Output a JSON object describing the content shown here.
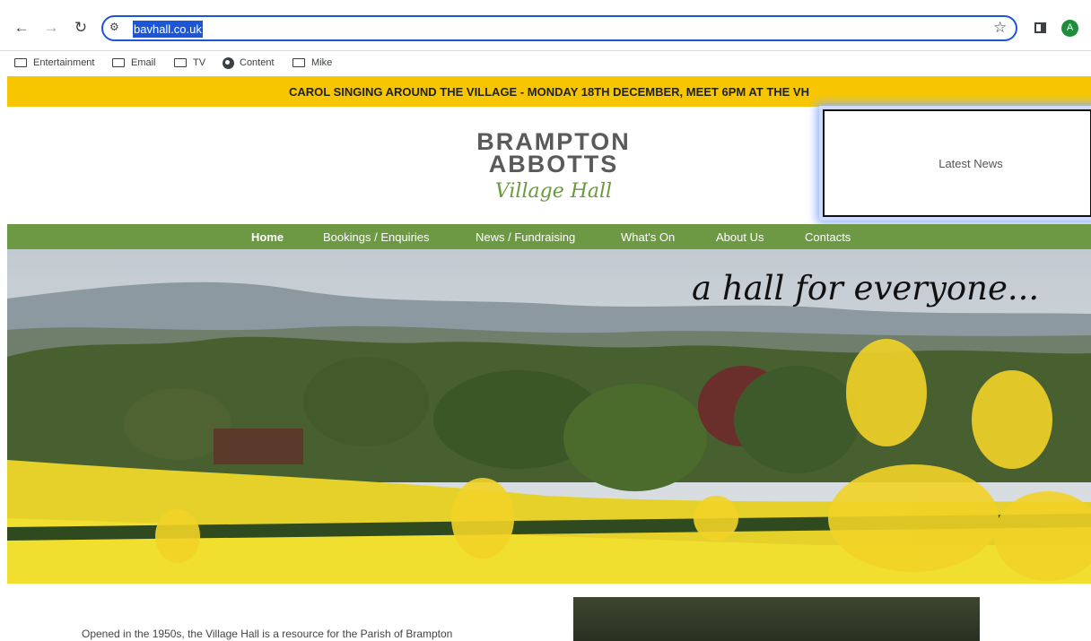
{
  "browser": {
    "url": "bavhall.co.uk",
    "profile_initial": "A",
    "nav_icons": [
      "back-arrow-icon",
      "forward-arrow-icon",
      "reload-icon"
    ],
    "bookmarks": [
      {
        "label": "Entertainment",
        "icon": "folder-icon"
      },
      {
        "label": "Email",
        "icon": "folder-icon"
      },
      {
        "label": "TV",
        "icon": "folder-icon"
      },
      {
        "label": "Content",
        "icon": "globe-icon"
      },
      {
        "label": "Mike",
        "icon": "folder-icon"
      }
    ],
    "accent_color": "#1a56d6"
  },
  "banner": {
    "text": "CAROL SINGING AROUND THE VILLAGE - MONDAY 18TH DECEMBER, MEET 6PM AT THE VH",
    "color": "#f7c600"
  },
  "logo": {
    "line1": "BRAMPTON",
    "line2": "ABBOTTS",
    "line3": "Village Hall"
  },
  "news_box": {
    "label": "Latest News"
  },
  "nav": {
    "color": "#6e9944",
    "items": [
      {
        "label": "Home",
        "active": true
      },
      {
        "label": "Bookings / Enquiries"
      },
      {
        "label": "News / Fundraising"
      },
      {
        "label": "What's On"
      },
      {
        "label": "About Us"
      },
      {
        "label": "Contacts"
      }
    ]
  },
  "hero": {
    "tagline": "a hall for everyone..."
  },
  "content": {
    "intro": "Opened in the 1950s, the Village Hall is a resource for the Parish of Brampton"
  }
}
